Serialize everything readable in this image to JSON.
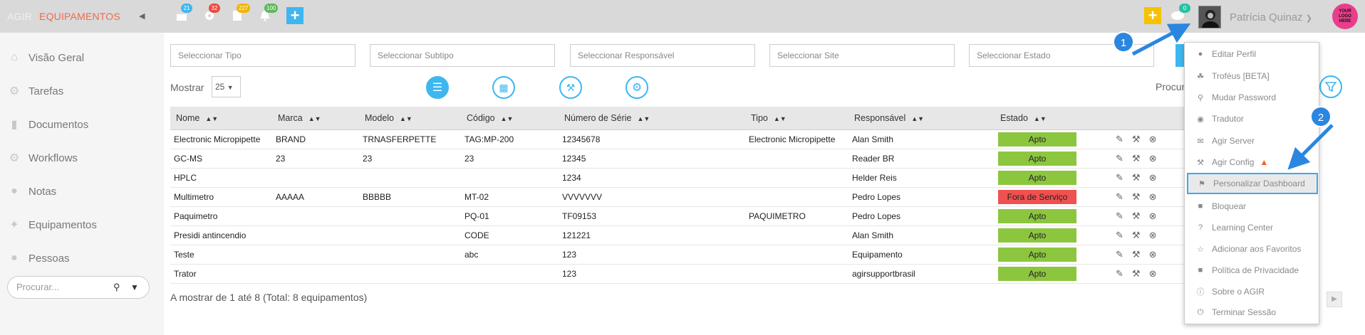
{
  "topbar": {
    "brand": "AGIR",
    "app_name": "EQUIPAMENTOS",
    "collapse_icon": "chevron-left-icon",
    "badges": [
      {
        "icon": "calendar-icon",
        "count": "21",
        "color": "#3eb7f0"
      },
      {
        "icon": "gear-icon",
        "count": "32",
        "color": "#e84c3d"
      },
      {
        "icon": "document-icon",
        "count": "227",
        "color": "#f0b400"
      },
      {
        "icon": "bell-icon",
        "count": "100",
        "color": "#5cb85c"
      }
    ],
    "chat_badge": "0",
    "user_name": "Patrícia Quinaz",
    "logo_text": "YOUR LOGO HERE"
  },
  "sidebar": {
    "items": [
      {
        "label": "Visão Geral",
        "icon": "home-icon"
      },
      {
        "label": "Tarefas",
        "icon": "gear-icon"
      },
      {
        "label": "Documentos",
        "icon": "file-icon"
      },
      {
        "label": "Workflows",
        "icon": "cogs-icon"
      },
      {
        "label": "Notas",
        "icon": "chat-icon"
      },
      {
        "label": "Equipamentos",
        "icon": "wrench-icon"
      },
      {
        "label": "Pessoas",
        "icon": "user-icon"
      }
    ],
    "search_placeholder": "Procurar..."
  },
  "filters": {
    "tipo": "Seleccionar Tipo",
    "subtipo": "Seleccionar Subtipo",
    "responsavel": "Seleccionar Responsável",
    "site": "Seleccionar Site",
    "estado": "Seleccionar Estado"
  },
  "toolbar": {
    "mostrar_label": "Mostrar",
    "page_size": "25",
    "procurar_label": "Procur"
  },
  "table": {
    "columns": [
      "Nome",
      "Marca",
      "Modelo",
      "Código",
      "Número de Série",
      "Tipo",
      "Responsável",
      "Estado"
    ],
    "rows": [
      [
        "Electronic Micropipette",
        "BRAND",
        "TRNASFERPETTE",
        "TAG:MP-200",
        "12345678",
        "Electronic Micropipette",
        "Alan Smith",
        "Apto"
      ],
      [
        "GC-MS",
        "23",
        "23",
        "23",
        "12345",
        "",
        "Reader BR",
        "Apto"
      ],
      [
        "HPLC",
        "",
        "",
        "",
        "1234",
        "",
        "Helder Reis",
        "Apto"
      ],
      [
        "Multimetro",
        "AAAAA",
        "BBBBB",
        "MT-02",
        "VVVVVVV",
        "",
        "Pedro Lopes",
        "Fora de Serviço"
      ],
      [
        "Paquimetro",
        "",
        "",
        "PQ-01",
        "TF09153",
        "PAQUIMETRO",
        "Pedro Lopes",
        "Apto"
      ],
      [
        "Presidi antincendio",
        "",
        "",
        "CODE",
        "121221",
        "",
        "Alan Smith",
        "Apto"
      ],
      [
        "Teste",
        "",
        "",
        "abc",
        "123",
        "",
        "Equipamento",
        "Apto"
      ],
      [
        "Trator",
        "",
        "",
        "",
        "123",
        "",
        "agirsupportbrasil",
        "Apto"
      ]
    ],
    "status_colors": {
      "Apto": "#8cc63f",
      "Fora de Serviço": "#f05050"
    },
    "footer": "A mostrar de 1 até 8 (Total: 8 equipamentos)"
  },
  "user_menu": {
    "items": [
      {
        "label": "Editar Perfil",
        "icon": "user-icon"
      },
      {
        "label": "Troféus [BETA]",
        "icon": "trophy-icon"
      },
      {
        "label": "Mudar Password",
        "icon": "key-icon"
      },
      {
        "label": "Tradutor",
        "icon": "globe-icon"
      },
      {
        "label": "Agir Server",
        "icon": "envelope-icon"
      },
      {
        "label": "Agir Config",
        "icon": "wrench-icon"
      },
      {
        "label": "Personalizar Dashboard",
        "icon": "flag-icon"
      },
      {
        "label": "Bloquear",
        "icon": "lock-icon"
      },
      {
        "label": "Learning Center",
        "icon": "question-icon"
      },
      {
        "label": "Adicionar aos Favoritos",
        "icon": "star-icon"
      },
      {
        "label": "Política de Privacidade",
        "icon": "lock-icon"
      },
      {
        "label": "Sobre o AGIR",
        "icon": "info-icon"
      },
      {
        "label": "Terminar Sessão",
        "icon": "power-icon"
      }
    ]
  },
  "annotations": {
    "marker_1": "1",
    "marker_2": "2",
    "color": "#2b86e0"
  }
}
